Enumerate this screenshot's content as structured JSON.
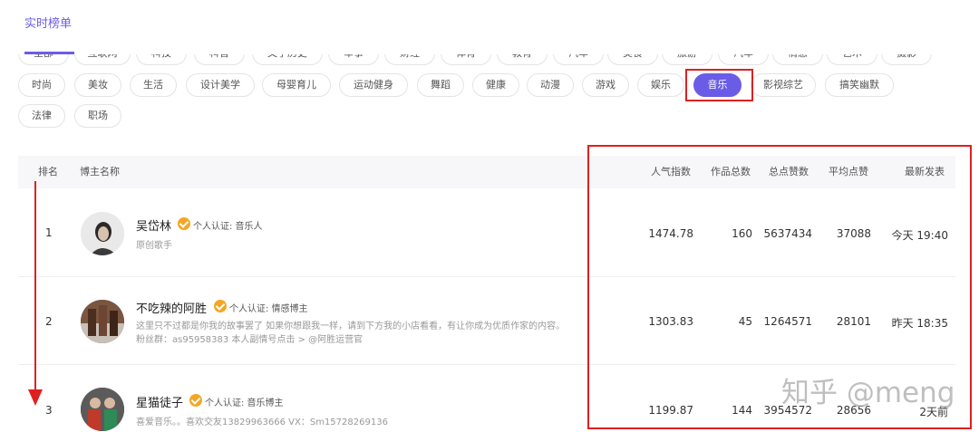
{
  "header": {
    "tab_label": "实时榜单"
  },
  "categories": {
    "row0": [
      "全部",
      "互联网",
      "科技",
      "科普",
      "文学历史",
      "军事",
      "财经",
      "体育",
      "教育",
      "汽车",
      "美食",
      "旅游",
      "汽车",
      "情感",
      "艺术",
      "摄影"
    ],
    "row1": [
      "时尚",
      "美妆",
      "生活",
      "设计美学",
      "母婴育儿",
      "运动健身",
      "舞蹈",
      "健康",
      "动漫",
      "游戏",
      "娱乐",
      "音乐",
      "影视综艺",
      "搞笑幽默"
    ],
    "row2": [
      "法律",
      "职场"
    ],
    "active": "音乐"
  },
  "table": {
    "headers": {
      "rank": "排名",
      "blogger": "博主名称",
      "popularity": "人气指数",
      "works": "作品总数",
      "likes": "总点赞数",
      "avg_likes": "平均点赞",
      "latest": "最新发表"
    },
    "rows": [
      {
        "rank": "1",
        "name": "吴岱林",
        "cert": "个人认证: 音乐人",
        "desc": "原创歌手",
        "popularity": "1474.78",
        "works": "160",
        "likes": "5637434",
        "avg_likes": "37088",
        "latest": "今天 19:40"
      },
      {
        "rank": "2",
        "name": "不吃辣的阿胜",
        "cert": "个人认证: 情感博主",
        "desc": "这里只不过都是你我的故事罢了 如果你想跟我一样，请到下方我的小店看看，有让你成为优质作家的内容。 粉丝群：as95958383 本人副情号点击 > @阿胜运营官",
        "popularity": "1303.83",
        "works": "45",
        "likes": "1264571",
        "avg_likes": "28101",
        "latest": "昨天 18:35"
      },
      {
        "rank": "3",
        "name": "星猫徒子",
        "cert": "个人认证: 音乐博主",
        "desc": "喜爱音乐。。喜欢交友13829963666 VX：Sm15728269136",
        "popularity": "1199.87",
        "works": "144",
        "likes": "3954572",
        "avg_likes": "28656",
        "latest": "2天前"
      }
    ]
  },
  "watermark": "知乎 @meng",
  "colors": {
    "accent": "#6b5ce7",
    "annotation": "#e02020",
    "verify": "#f5a623"
  }
}
